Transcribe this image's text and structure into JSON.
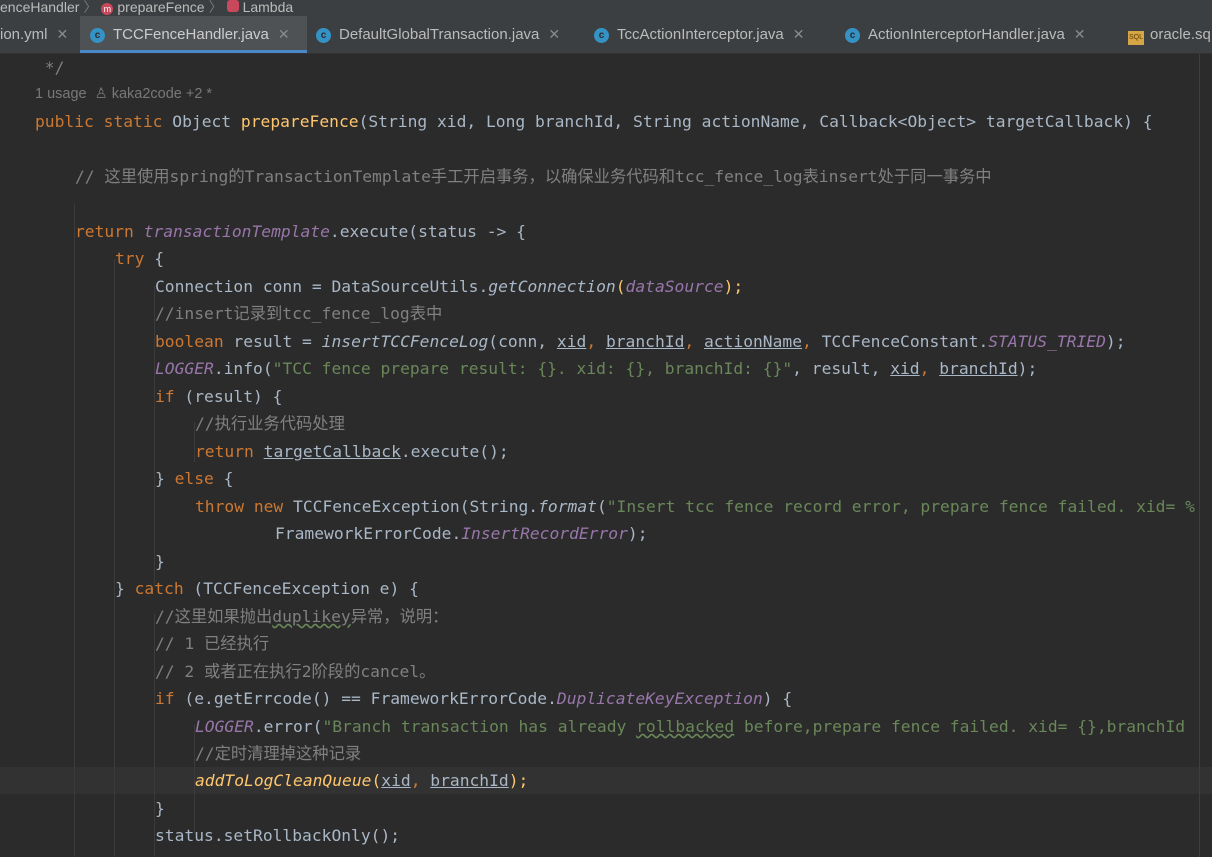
{
  "breadcrumb": {
    "items": [
      "enceHandler",
      "prepareFence",
      "Lambda"
    ]
  },
  "tabs": [
    {
      "label": "ion.yml",
      "icon": "yaml-file-icon",
      "active": false
    },
    {
      "label": "TCCFenceHandler.java",
      "icon": "java-class-icon",
      "active": true
    },
    {
      "label": "DefaultGlobalTransaction.java",
      "icon": "java-class-icon",
      "active": false
    },
    {
      "label": "TccActionInterceptor.java",
      "icon": "java-class-icon",
      "active": false
    },
    {
      "label": "ActionInterceptorHandler.java",
      "icon": "java-class-icon",
      "active": false
    },
    {
      "label": "oracle.sq",
      "icon": "sql-file-icon",
      "active": false
    }
  ],
  "close_glyph": "✕",
  "hints": {
    "usages": "1 usage",
    "authors": "kaka2code +2 *"
  },
  "code": {
    "comment_end": " */",
    "sig_public": "public",
    "sig_static": "static",
    "sig_ret": "Object",
    "sig_name": "prepareFence",
    "sig_params": "(String xid, Long branchId, String actionName, Callback<Object> targetCallback) {",
    "cn_comment": "// 这里使用spring的TransactionTemplate手工开启事务，以确保业务代码和tcc_fence_log表insert处于同一事务中",
    "ret_kw": "return",
    "ret_field": "transactionTemplate",
    "ret_rest": ".execute(status -> {",
    "try_kw": "try",
    "brace_open": " {",
    "conn_a": "Connection conn = DataSourceUtils.",
    "conn_fn": "getConnection",
    "conn_paren": "(",
    "conn_field": "dataSource",
    "conn_end": ");",
    "ins_comment": "//insert记录到tcc_fence_log表中",
    "bool_kw": "boolean",
    "bool_a": " result = ",
    "bool_fn": "insertTCCFenceLog",
    "bool_b": "(conn, ",
    "p_xid": "xid",
    "p_branch": "branchId",
    "p_action": "actionName",
    "comma": ", ",
    "bool_c": "TCCFenceConstant.",
    "bool_const": "STATUS_TRIED",
    "bool_end": ");",
    "log_field": "LOGGER",
    "log_a": ".info(",
    "log_str": "\"TCC fence prepare result: {}. xid: {}, branchId: {}\"",
    "log_b": ", result, ",
    "log_end": ");",
    "if_kw": "if",
    "if_rest": " (result) {",
    "biz_comment": "//执行业务代码处理",
    "ret2_kw": "return",
    "ret2_param": "targetCallback",
    "ret2_rest": ".execute();",
    "else_a": "} ",
    "else_kw": "else",
    "else_b": " {",
    "throw_kw": "throw",
    "new_kw": "new",
    "throw_a": " TCCFenceException(String.",
    "throw_fn": "format",
    "throw_b": "(",
    "throw_str": "\"Insert tcc fence record error, prepare fence failed. xid= %",
    "fw_a": "FrameworkErrorCode.",
    "fw_const": "InsertRecordError",
    "fw_end": ");",
    "close_brace": "}",
    "catch_a": "} ",
    "catch_kw": "catch",
    "catch_b": " (TCCFenceException e) {",
    "dup_a": "//这里如果抛出",
    "dup_word": "duplikey",
    "dup_b": "异常，说明：",
    "dup1": "// 1 已经执行",
    "dup2": "// 2 或者正在执行2阶段的cancel。",
    "if2_kw": "if",
    "if2_a": " (e.getErrcode() == FrameworkErrorCode.",
    "if2_const": "DuplicateKeyException",
    "if2_b": ") {",
    "err_field": "LOGGER",
    "err_a": ".error(",
    "err_str_a": "\"Branch transaction has already ",
    "err_str_word": "rollbacked",
    "err_str_b": " before,prepare fence failed. xid= {},branchId",
    "clean_comment": "//定时清理掉这种记录",
    "add_fn": "addToLogCleanQueue",
    "add_a": "(",
    "add_end": ");",
    "status_line": "status.setRollbackOnly();"
  }
}
